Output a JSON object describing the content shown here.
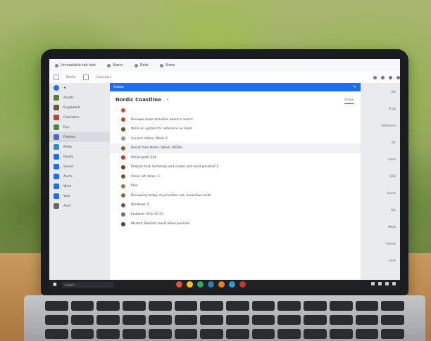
{
  "browser": {
    "tabs": [
      {
        "label": "Unreadable tab text"
      },
      {
        "label": "Alerts"
      },
      {
        "label": "Desk"
      },
      {
        "label": "Store"
      }
    ]
  },
  "toolbar": {
    "items": [
      "Media",
      "Calendars"
    ]
  },
  "sidebar": {
    "items": [
      {
        "label": "Assets"
      },
      {
        "label": "Bugsketch"
      },
      {
        "label": "Calendars"
      },
      {
        "label": "Run"
      },
      {
        "label": "Pixelset"
      },
      {
        "label": "Mello"
      },
      {
        "label": "Ready"
      },
      {
        "label": "Saved"
      },
      {
        "label": "Alerts"
      },
      {
        "label": "Wind"
      },
      {
        "label": "Velo"
      },
      {
        "label": "Alert"
      }
    ]
  },
  "main": {
    "header_label": "Inbox",
    "title": "Nordic Coastline",
    "filter_label": "Views",
    "rows": [
      {
        "text": "",
        "color": "#d24d2b"
      },
      {
        "text": "Reviews more activities about a recent",
        "color": "#b04a2a"
      },
      {
        "text": "Write an update for reference on Team",
        "color": "#6b4f2b"
      },
      {
        "text": "Current status: Week 3",
        "color": "#999999"
      },
      {
        "text": "Result from Notes (Week 1602b)",
        "color": "#8a5a30"
      },
      {
        "text": "Utilize/path 224",
        "color": "#c0392b"
      },
      {
        "text": "Prepare task Summary and create and send pre-brief 3",
        "color": "#7a3b2e"
      },
      {
        "text": "Clean list items: 3",
        "color": "#6b5a3a"
      },
      {
        "text": "Plan",
        "color": "#a07840"
      },
      {
        "text": "Reviewing today, re-prioritize use, overview result",
        "color": "#8a6a3a"
      },
      {
        "text": "Windows: 5",
        "color": "#5a5a5a"
      },
      {
        "text": "Prefetch: PFile 50 23",
        "color": "#7a6a5a"
      },
      {
        "text": "Market: Nearest result when pre-lists",
        "color": "#444444"
      }
    ]
  },
  "right_panel": {
    "items": [
      "5th",
      "Pl 2p",
      "Reference",
      "Dir",
      "Sales",
      "Q4D",
      "Issues",
      "Apr",
      "Week",
      "Entries",
      "Links"
    ]
  },
  "taskbar": {
    "search_placeholder": "Search",
    "app_colors": [
      "#e74c3c",
      "#f1c40f",
      "#27ae60",
      "#2980b9",
      "#e67e22",
      "#3498db",
      "#c0392b"
    ]
  }
}
